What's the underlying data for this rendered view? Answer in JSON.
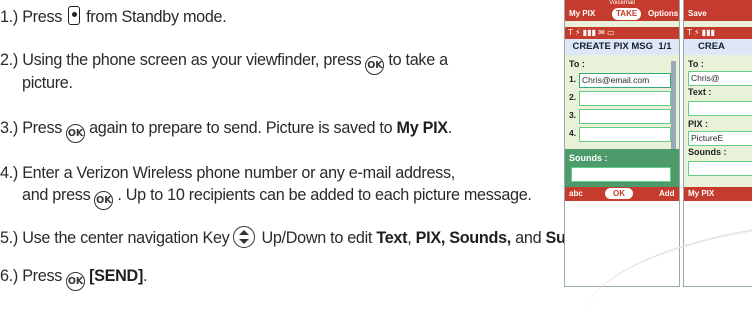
{
  "steps": [
    {
      "id": 1,
      "prefix": "1.) Press",
      "after_key": "from Standby mode."
    },
    {
      "id": 2,
      "line1_before": "2.) Using the phone screen as your viewfinder, press",
      "line1_after": "to take a",
      "line2": "picture."
    },
    {
      "id": 3,
      "before": "3.) Press",
      "middle": "again to prepare to send. Picture is saved to",
      "bold": "My PIX",
      "end": "."
    },
    {
      "id": 4,
      "line1": "4.) Enter a Verizon Wireless phone number or any e-mail address,",
      "line2_before": "and press",
      "line2_after": ". Up to 10 recipients can be added to each picture message."
    },
    {
      "id": 5,
      "before": "5.) Use the center navigation Key",
      "mid": "Up/Down to edit",
      "b1": "Text",
      "sep1": ",",
      "b2": "PIX,",
      "b3": "Sounds,",
      "and": "and",
      "b4": "Subject",
      "end": "."
    },
    {
      "id": 6,
      "before": "6.) Press",
      "bold": "[SEND]",
      "end": "."
    }
  ],
  "key_ok_label": "OK",
  "phone_left": {
    "top_status": "Voicemail",
    "softkeys_top": {
      "left": "My PIX",
      "center": "TAKE",
      "right": "Options"
    },
    "status_icons": "T ⚡ ▮▮▮    ✉     ▭",
    "title": "CREATE PIX MSG",
    "page": "1/1",
    "to_label": "To :",
    "recipients": [
      {
        "num": "1.",
        "value": "Chris@email.com"
      },
      {
        "num": "2.",
        "value": ""
      },
      {
        "num": "3.",
        "value": ""
      },
      {
        "num": "4.",
        "value": ""
      }
    ],
    "sounds_label": "Sounds :",
    "softkeys_bottom": {
      "left": "abc",
      "center": "OK",
      "right": "Add"
    }
  },
  "phone_right": {
    "softkeys_top": {
      "left": "Save"
    },
    "status_icons": "T ⚡ ▮▮▮",
    "title": "CREA",
    "to_label": "To :",
    "to_value": "Chris@",
    "text_label": "Text :",
    "pix_label": "PIX :",
    "pix_value": "PictureE",
    "sounds_label": "Sounds :",
    "softkeys_bottom": {
      "left": "My PIX"
    }
  },
  "colors": {
    "accent_red": "#c53b2d",
    "screen_bg": "#e9f2d8",
    "text": "#2a2a2a"
  }
}
